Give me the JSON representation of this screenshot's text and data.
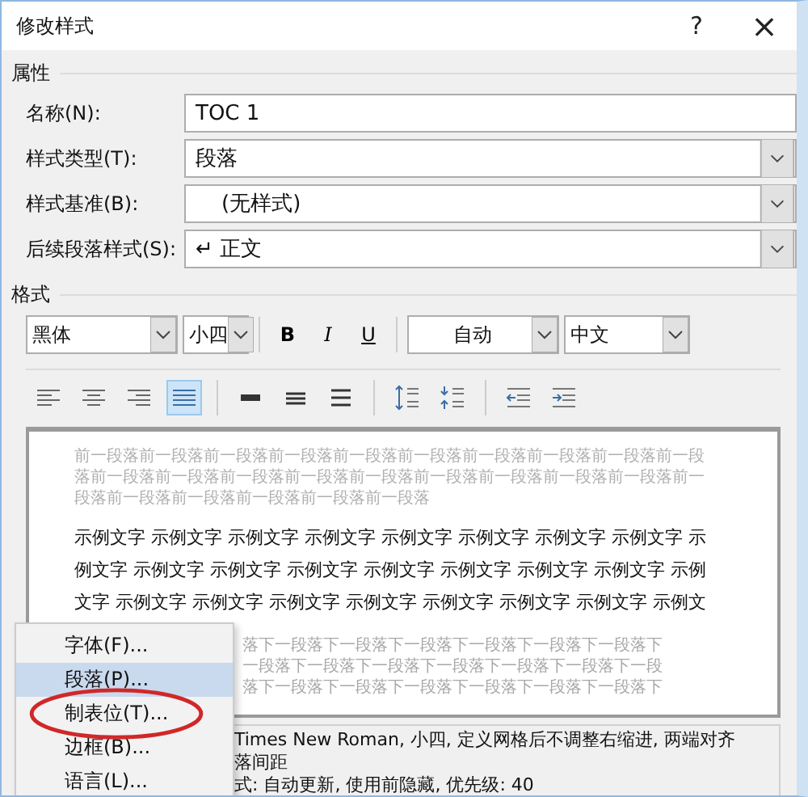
{
  "window": {
    "title": "修改样式",
    "help": "?",
    "close": "×"
  },
  "properties": {
    "heading": "属性",
    "fields": [
      {
        "label": "名称(N):",
        "kind": "text",
        "value": "TOC 1"
      },
      {
        "label": "样式类型(T):",
        "kind": "select",
        "value": "段落"
      },
      {
        "label": "样式基准(B):",
        "kind": "select",
        "value": "(无样式)"
      },
      {
        "label": "后续段落样式(S):",
        "kind": "select",
        "value": "↵ 正文"
      }
    ]
  },
  "format": {
    "heading": "格式",
    "font": "黑体",
    "size": "小四",
    "styles": [
      {
        "kind": "bold",
        "label": "B",
        "selected": false
      },
      {
        "kind": "italic",
        "label": "I",
        "selected": false
      },
      {
        "kind": "underline",
        "label": "U",
        "selected": false
      }
    ],
    "font_color": "自动",
    "script": "中文",
    "alignment": [
      {
        "kind": "left",
        "selected": false
      },
      {
        "kind": "center",
        "selected": false
      },
      {
        "kind": "right",
        "selected": false
      },
      {
        "kind": "justify",
        "selected": true
      }
    ],
    "spacing": [
      {
        "kind": "single"
      },
      {
        "kind": "one-half"
      },
      {
        "kind": "double"
      }
    ],
    "paragraph_spacing": [
      {
        "kind": "increase"
      },
      {
        "kind": "decrease"
      }
    ],
    "indent": [
      {
        "kind": "decrease"
      },
      {
        "kind": "increase"
      }
    ]
  },
  "preview": {
    "previous": "前一段落前一段落前一段落前一段落前一段落前一段落前一段落前一段落前一段落前一段落前一段落前一段落前一段落前一段落前一段落前一段落前一段落前一段落前一段落前一段落前一段落前一段落前一段落前一段落前一段落",
    "sample": [
      "示例文字 示例文字 示例文字 示例文字 示例文字 示例文字 示例文字 示例文字 示",
      "例文字 示例文字 示例文字 示例文字 示例文字 示例文字 示例文字 示例文字 示例",
      "文字 示例文字 示例文字 示例文字 示例文字 示例文字 示例文字 示例文字 示例文"
    ],
    "next": [
      "落下一段落下一段落下一段落下一段落下一段落下一段落下",
      "一段落下一段落下一段落下一段落下一段落下一段落下一段",
      "落下一段落下一段落下一段落下一段落下一段落下一段落下"
    ]
  },
  "description": [
    "Times New Roman, 小四, 定义网格后不调整右缩进, 两端对齐",
    "落间距",
    "式: 自动更新, 使用前隐藏, 优先级: 40"
  ],
  "menu": [
    {
      "label": "字体(F)...",
      "selected": false,
      "circled": false
    },
    {
      "label": "段落(P)...",
      "selected": true,
      "circled": false
    },
    {
      "label": "制表位(T)...",
      "selected": false,
      "circled": true
    },
    {
      "label": "边框(B)...",
      "selected": false,
      "circled": false
    },
    {
      "label": "语言(L)...",
      "selected": false,
      "circled": false
    }
  ]
}
